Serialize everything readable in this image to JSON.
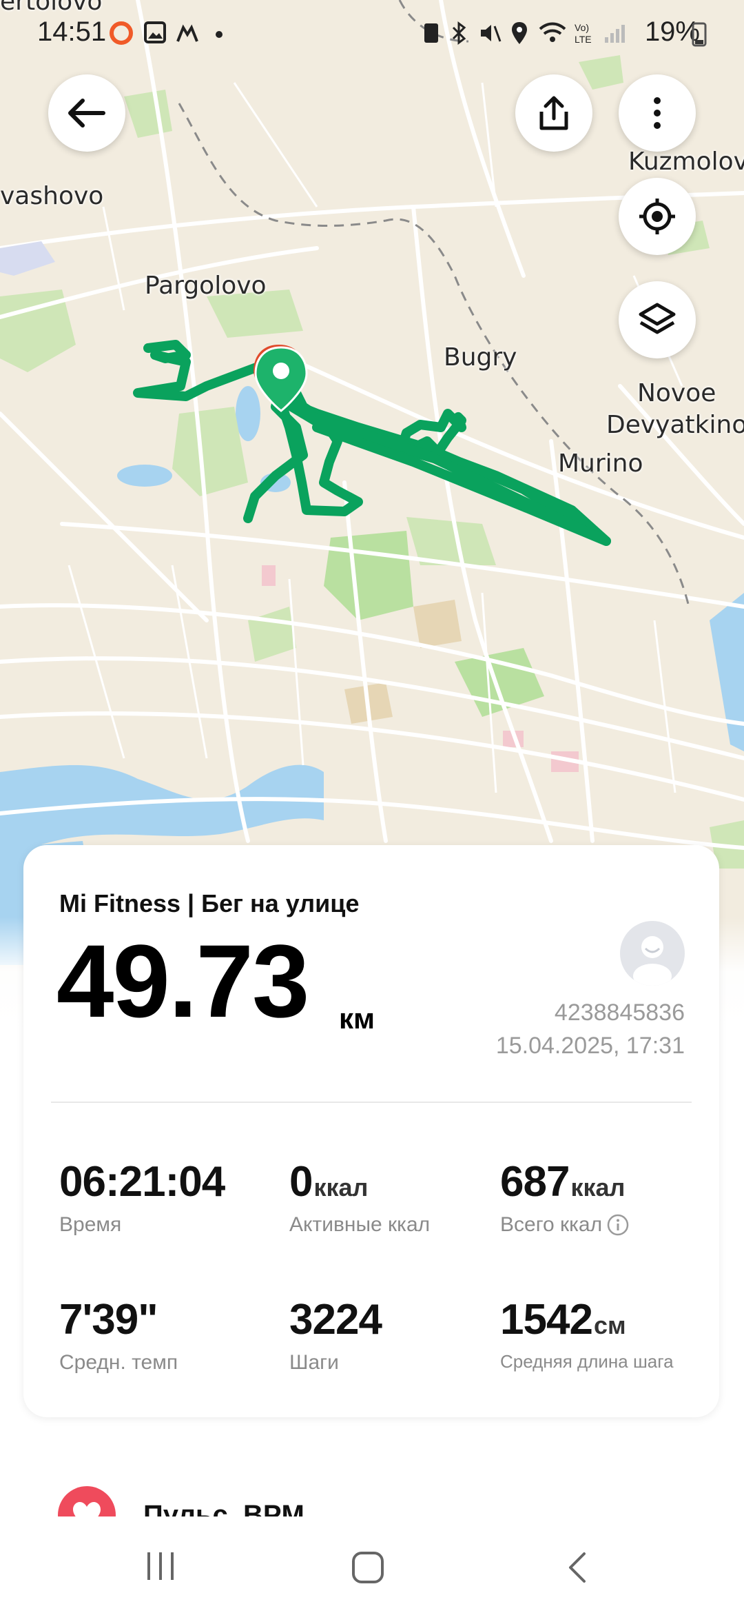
{
  "status_bar": {
    "time": "14:51",
    "battery": "19%"
  },
  "map": {
    "labels": [
      {
        "key": "v",
        "text": "vashovo"
      },
      {
        "key": "p",
        "text": "Pargolovo"
      },
      {
        "key": "b",
        "text": "Bugry"
      },
      {
        "key": "k",
        "text": "Kuzmolov"
      },
      {
        "key": "n",
        "text": "Novoe\nDevyatkino"
      },
      {
        "key": "m",
        "text": "Murino"
      },
      {
        "key": "t",
        "text": "ertolovo"
      }
    ],
    "route_color": "#0aa25d",
    "marker_color": "#1db36b"
  },
  "toolbar": {
    "back_icon": "arrow-left-icon",
    "share_icon": "share-icon",
    "more_icon": "more-vert-icon",
    "locate_icon": "crosshair-icon",
    "layers_icon": "layers-icon"
  },
  "summary": {
    "title": "Mi Fitness | Бег на улице",
    "distance": "49.73",
    "distance_unit": "км",
    "user_id": "4238845836",
    "date": "15.04.2025, 17:31"
  },
  "stats": [
    {
      "value": "06:21:04",
      "unit": "",
      "label": "Время"
    },
    {
      "value": "0",
      "unit": "ккал",
      "label": "Активные ккал"
    },
    {
      "value": "687",
      "unit": "ккал",
      "label": "Всего ккал"
    },
    {
      "value": "7'39\"",
      "unit": "",
      "label": "Средн. темп"
    },
    {
      "value": "3224",
      "unit": "",
      "label": "Шаги"
    },
    {
      "value": "1542",
      "unit": "см",
      "label": "Средняя длина шага"
    }
  ],
  "heart_section": {
    "label": "Пульс, BPM"
  },
  "nav": {
    "recents_icon": "recents-icon",
    "home_icon": "home-icon",
    "back_icon": "back-icon"
  }
}
